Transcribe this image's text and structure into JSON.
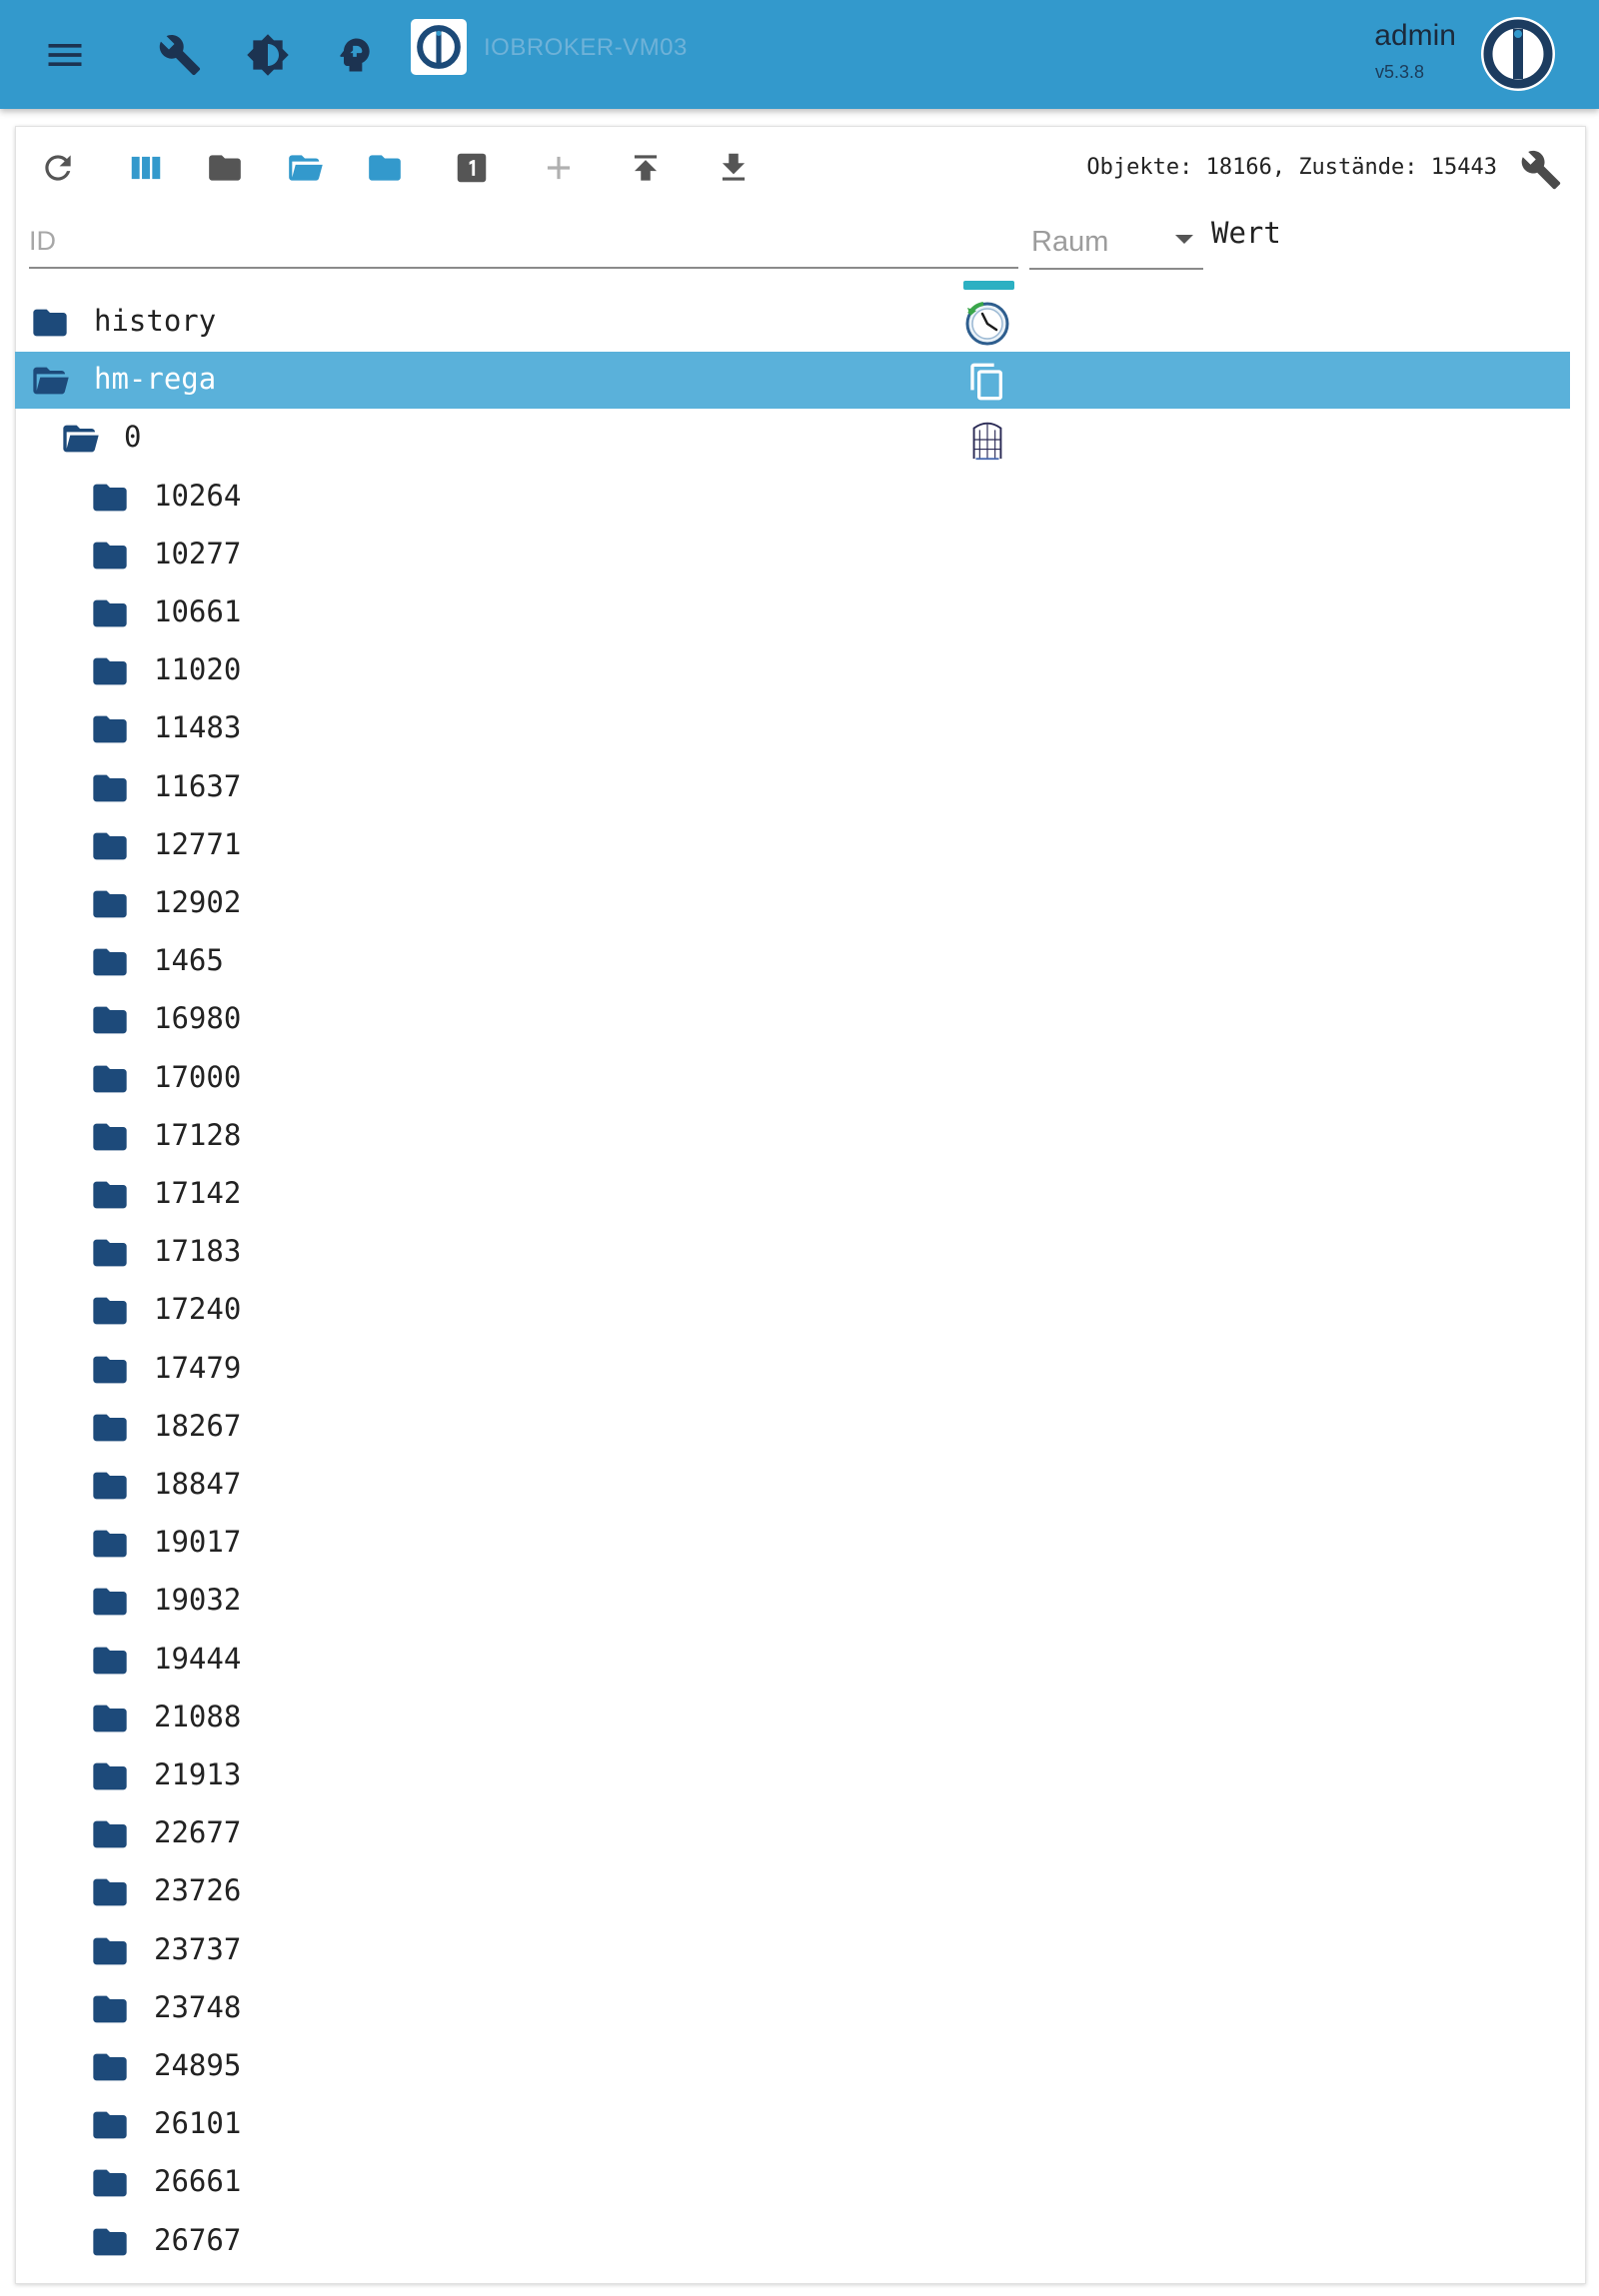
{
  "appbar": {
    "menu_icon": "menu-icon",
    "tools_icon": "wrench-icon",
    "theme_icon": "theme-brightness-icon",
    "expert_icon": "expert-mode-head-icon",
    "host_title": "IOBROKER-VM03",
    "user_name": "admin",
    "version": "v5.3.8",
    "bar_color": "#3399cc"
  },
  "toolbar": {
    "buttons": [
      {
        "name": "refresh-icon"
      },
      {
        "name": "columns-icon"
      },
      {
        "name": "folder-icon"
      },
      {
        "name": "folder-open-icon"
      },
      {
        "name": "folder-closed-icon"
      },
      {
        "name": "number-one-icon"
      },
      {
        "name": "add-icon"
      },
      {
        "name": "upload-icon"
      },
      {
        "name": "download-icon"
      }
    ],
    "counts_text": "Objekte: 18166, Zustände: 15443",
    "settings_icon": "wrench-icon"
  },
  "filters": {
    "id_placeholder": "ID",
    "room_label": "Raum",
    "value_header": "Wert"
  },
  "tree": {
    "rows": [
      {
        "label": "history",
        "level": 0,
        "open": false,
        "selected": false,
        "adapter_icon": "history-clock-icon"
      },
      {
        "label": "hm-rega",
        "level": 0,
        "open": true,
        "selected": true,
        "adapter_icon": "copy-icon"
      },
      {
        "label": "0",
        "level": 1,
        "open": true,
        "selected": false,
        "adapter_icon": "homematic-icon"
      },
      {
        "label": "10264",
        "level": 2
      },
      {
        "label": "10277",
        "level": 2
      },
      {
        "label": "10661",
        "level": 2
      },
      {
        "label": "11020",
        "level": 2
      },
      {
        "label": "11483",
        "level": 2
      },
      {
        "label": "11637",
        "level": 2
      },
      {
        "label": "12771",
        "level": 2
      },
      {
        "label": "12902",
        "level": 2
      },
      {
        "label": "1465",
        "level": 2
      },
      {
        "label": "16980",
        "level": 2
      },
      {
        "label": "17000",
        "level": 2
      },
      {
        "label": "17128",
        "level": 2
      },
      {
        "label": "17142",
        "level": 2
      },
      {
        "label": "17183",
        "level": 2
      },
      {
        "label": "17240",
        "level": 2
      },
      {
        "label": "17479",
        "level": 2
      },
      {
        "label": "18267",
        "level": 2
      },
      {
        "label": "18847",
        "level": 2
      },
      {
        "label": "19017",
        "level": 2
      },
      {
        "label": "19032",
        "level": 2
      },
      {
        "label": "19444",
        "level": 2
      },
      {
        "label": "21088",
        "level": 2
      },
      {
        "label": "21913",
        "level": 2
      },
      {
        "label": "22677",
        "level": 2
      },
      {
        "label": "23726",
        "level": 2
      },
      {
        "label": "23737",
        "level": 2
      },
      {
        "label": "23748",
        "level": 2
      },
      {
        "label": "24895",
        "level": 2
      },
      {
        "label": "26101",
        "level": 2
      },
      {
        "label": "26661",
        "level": 2
      },
      {
        "label": "26767",
        "level": 2
      }
    ]
  },
  "colors": {
    "folder": "#1d4a7a",
    "folder_open_toolbar": "#3399cc",
    "selected_row": "#5ab1da",
    "accent_teal": "#2cb0c2"
  }
}
